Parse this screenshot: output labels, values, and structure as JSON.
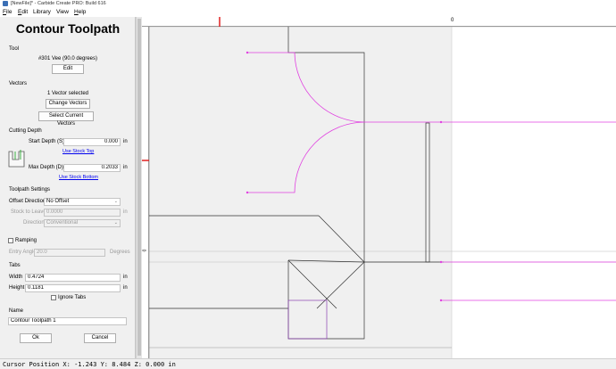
{
  "window": {
    "title": "[NewFile]* - Carbide Create PRO: Build 616"
  },
  "menu": [
    {
      "label": "File",
      "ul": "F",
      "rest": "ile"
    },
    {
      "label": "Edit",
      "ul": "E",
      "rest": "dit"
    },
    {
      "label": "Library",
      "ul": "",
      "rest": "Library"
    },
    {
      "label": "View",
      "ul": "",
      "rest": "View"
    },
    {
      "label": "Help",
      "ul": "H",
      "rest": "elp"
    }
  ],
  "panel": {
    "title": "Contour Toolpath",
    "tool": {
      "section": "Tool",
      "name": "#301 Vee (90.0 degrees)",
      "edit_label": "Edit"
    },
    "vectors": {
      "section": "Vectors",
      "selected_text": "1 Vector selected",
      "change_label": "Change Vectors",
      "select_label": "Select Current Vectors"
    },
    "cutting_depth": {
      "section": "Cutting Depth",
      "start_label": "Start Depth (S)",
      "start_value": "0.000",
      "start_unit": "in",
      "use_stock_top": "Use Stock Top",
      "max_label": "Max Depth (D)",
      "max_value": "0.2033",
      "max_unit": "in",
      "use_stock_bottom": "Use Stock Bottom"
    },
    "toolpath_settings": {
      "section": "Toolpath Settings",
      "offset_label": "Offset Direction",
      "offset_value": "No Offset",
      "stock_label": "Stock to Leave",
      "stock_value": "0.0000",
      "stock_unit": "in",
      "direction_label": "Direction",
      "direction_value": "Conventional"
    },
    "ramping": {
      "label": "Ramping",
      "checked": false,
      "entry_label": "Entry Angle",
      "entry_value": "20.0",
      "entry_unit": "Degrees"
    },
    "tabs": {
      "section": "Tabs",
      "width_label": "Width",
      "width_value": "0.4724",
      "width_unit": "in",
      "height_label": "Height",
      "height_value": "0.1181",
      "height_unit": "in",
      "ignore_label": "Ignore Tabs",
      "ignore_checked": false
    },
    "name": {
      "section": "Name",
      "value": "Contour Toolpath 1"
    },
    "ok_label": "Ok",
    "cancel_label": "Cancel"
  },
  "ruler": {
    "top_zero": "0",
    "left_zero": "0"
  },
  "colors": {
    "toolpath": "#e040e0",
    "geometry": "#333333",
    "stock_fill": "#f0f0f0",
    "cursor_marker": "#e02020",
    "selected_vector": "#8a3fb0"
  },
  "status": {
    "text": "Cursor Position X: -1.243 Y: 8.484 Z: 0.000 in"
  }
}
